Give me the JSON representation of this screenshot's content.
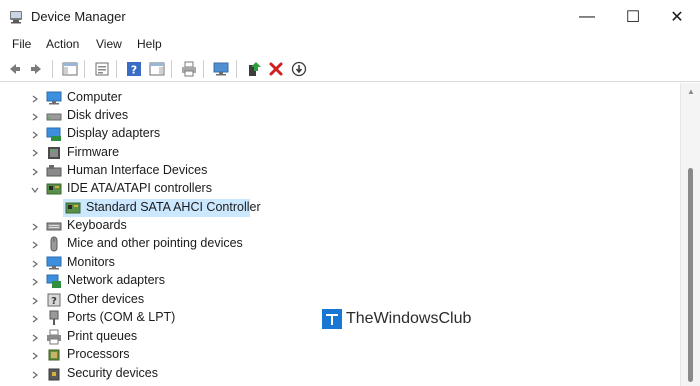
{
  "window": {
    "title": "Device Manager",
    "controls": {
      "minimize": "—",
      "maximize": "☐",
      "close": "✕"
    }
  },
  "menu": [
    "File",
    "Action",
    "View",
    "Help"
  ],
  "toolbar": {
    "buttons": [
      "back",
      "forward",
      "show-hide-console-tree",
      "properties",
      "help",
      "action-pane",
      "print",
      "scan-hardware",
      "update-driver",
      "uninstall-device",
      "disable-device"
    ]
  },
  "tree": {
    "items": [
      {
        "label": "Computer",
        "expanded": false,
        "icon": "computer-icon"
      },
      {
        "label": "Disk drives",
        "expanded": false,
        "icon": "disk-drive-icon"
      },
      {
        "label": "Display adapters",
        "expanded": false,
        "icon": "display-adapter-icon"
      },
      {
        "label": "Firmware",
        "expanded": false,
        "icon": "firmware-icon"
      },
      {
        "label": "Human Interface Devices",
        "expanded": false,
        "icon": "hid-icon"
      },
      {
        "label": "IDE ATA/ATAPI controllers",
        "expanded": true,
        "icon": "ide-controller-icon"
      },
      {
        "label": "Standard SATA AHCI Controller",
        "child": true,
        "selected": true,
        "icon": "sata-controller-icon"
      },
      {
        "label": "Keyboards",
        "expanded": false,
        "icon": "keyboard-icon"
      },
      {
        "label": "Mice and other pointing devices",
        "expanded": false,
        "icon": "mouse-icon"
      },
      {
        "label": "Monitors",
        "expanded": false,
        "icon": "monitor-icon"
      },
      {
        "label": "Network adapters",
        "expanded": false,
        "icon": "network-adapter-icon"
      },
      {
        "label": "Other devices",
        "expanded": false,
        "icon": "other-devices-icon"
      },
      {
        "label": "Ports (COM & LPT)",
        "expanded": false,
        "icon": "ports-icon"
      },
      {
        "label": "Print queues",
        "expanded": false,
        "icon": "printer-icon"
      },
      {
        "label": "Processors",
        "expanded": false,
        "icon": "processor-icon"
      },
      {
        "label": "Security devices",
        "expanded": false,
        "icon": "security-device-icon"
      }
    ]
  },
  "watermark": {
    "text": "TheWindowsClub"
  },
  "colors": {
    "selection": "#cce8ff",
    "accent": "#1976d2",
    "scroll_thumb": "#8a8a8a"
  }
}
